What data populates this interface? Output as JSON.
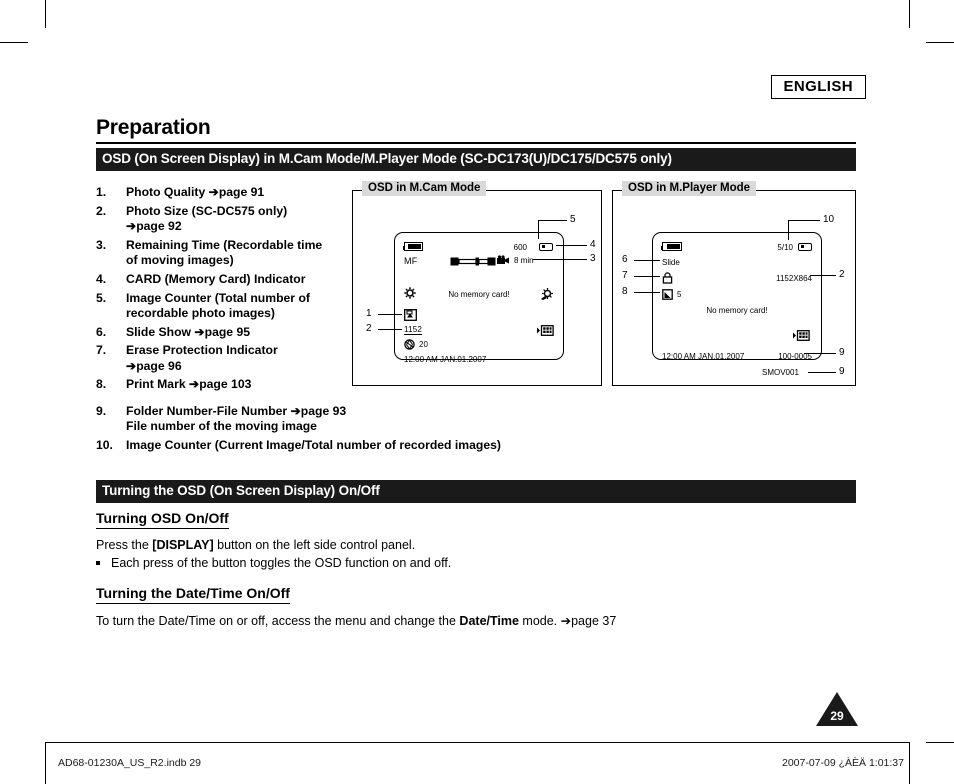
{
  "header": {
    "language_badge": "ENGLISH",
    "page_title": "Preparation"
  },
  "sections": {
    "bar_osd": "OSD (On Screen Display) in M.Cam Mode/M.Player Mode (SC-DC173(U)/DC175/DC575 only)",
    "bar_turning": "Turning the OSD (On Screen Display) On/Off"
  },
  "legend": {
    "items": [
      {
        "num": "1.",
        "text": "Photo Quality ",
        "ref": "➔page 91"
      },
      {
        "num": "2.",
        "text": "Photo Size (SC-DC575 only)",
        "line2": "➔page 92"
      },
      {
        "num": "3.",
        "text": "Remaining Time (Recordable time",
        "line2": "of moving images)"
      },
      {
        "num": "4.",
        "text": "CARD (Memory Card) Indicator"
      },
      {
        "num": "5.",
        "text": "Image Counter (Total number of",
        "line2": "recordable photo images)"
      },
      {
        "num": "6.",
        "text": "Slide Show ",
        "ref": "➔page 95"
      },
      {
        "num": "7.",
        "text": "Erase Protection Indicator",
        "line2": "➔page 96"
      },
      {
        "num": "8.",
        "text": "Print Mark ",
        "ref": "➔page 103"
      },
      {
        "num": "9.",
        "text": "Folder Number-File Number ",
        "ref": "➔page 93",
        "line2": "File number of the moving image"
      }
    ],
    "item10": {
      "num": "10.",
      "text": "Image Counter (Current Image/Total number of recorded images)"
    }
  },
  "figure_mcam": {
    "label": "OSD in M.Cam Mode",
    "osd": {
      "focus_mode": "MF",
      "image_counter": "600",
      "remaining_time": "8 min",
      "photo_size": "1152",
      "exposure_value": "20",
      "message": "No memory card!",
      "datetime": "12:00 AM JAN.01.2007"
    },
    "callouts": [
      "1",
      "2",
      "3",
      "4",
      "5"
    ]
  },
  "figure_mplayer": {
    "label": "OSD in M.Player Mode",
    "osd": {
      "slide_show": "Slide",
      "print_mark_count": "5",
      "image_counter": "5/10",
      "photo_size": "1152X864",
      "message": "No memory card!",
      "datetime": "12:00 AM JAN.01.2007",
      "folder_file": "100-0005",
      "movie_file": "SMOV001"
    },
    "callouts": [
      "6",
      "7",
      "8",
      "9",
      "9b",
      "10",
      "2"
    ]
  },
  "turning_osd": {
    "heading": "Turning OSD On/Off",
    "line_a_pre": "Press the ",
    "line_a_bold": "[DISPLAY]",
    "line_a_post": " button on the left side control panel.",
    "bullet": "Each press of the button toggles the OSD function on and off."
  },
  "turning_datetime": {
    "heading": "Turning the Date/Time On/Off",
    "line_pre": "To turn the Date/Time on or off, access the menu and change the ",
    "line_bold": "Date/Time",
    "line_post": " mode. ",
    "line_ref": "➔page 37"
  },
  "page_number": "29",
  "footer": {
    "left": "AD68-01230A_US_R2.indb   29",
    "right": "2007-07-09   ¿ÀÈÄ 1:01:37"
  },
  "colors": {
    "bar_bg": "#1a1a1a",
    "fig_label_bg": "#d9d9d9",
    "text": "#000000"
  }
}
